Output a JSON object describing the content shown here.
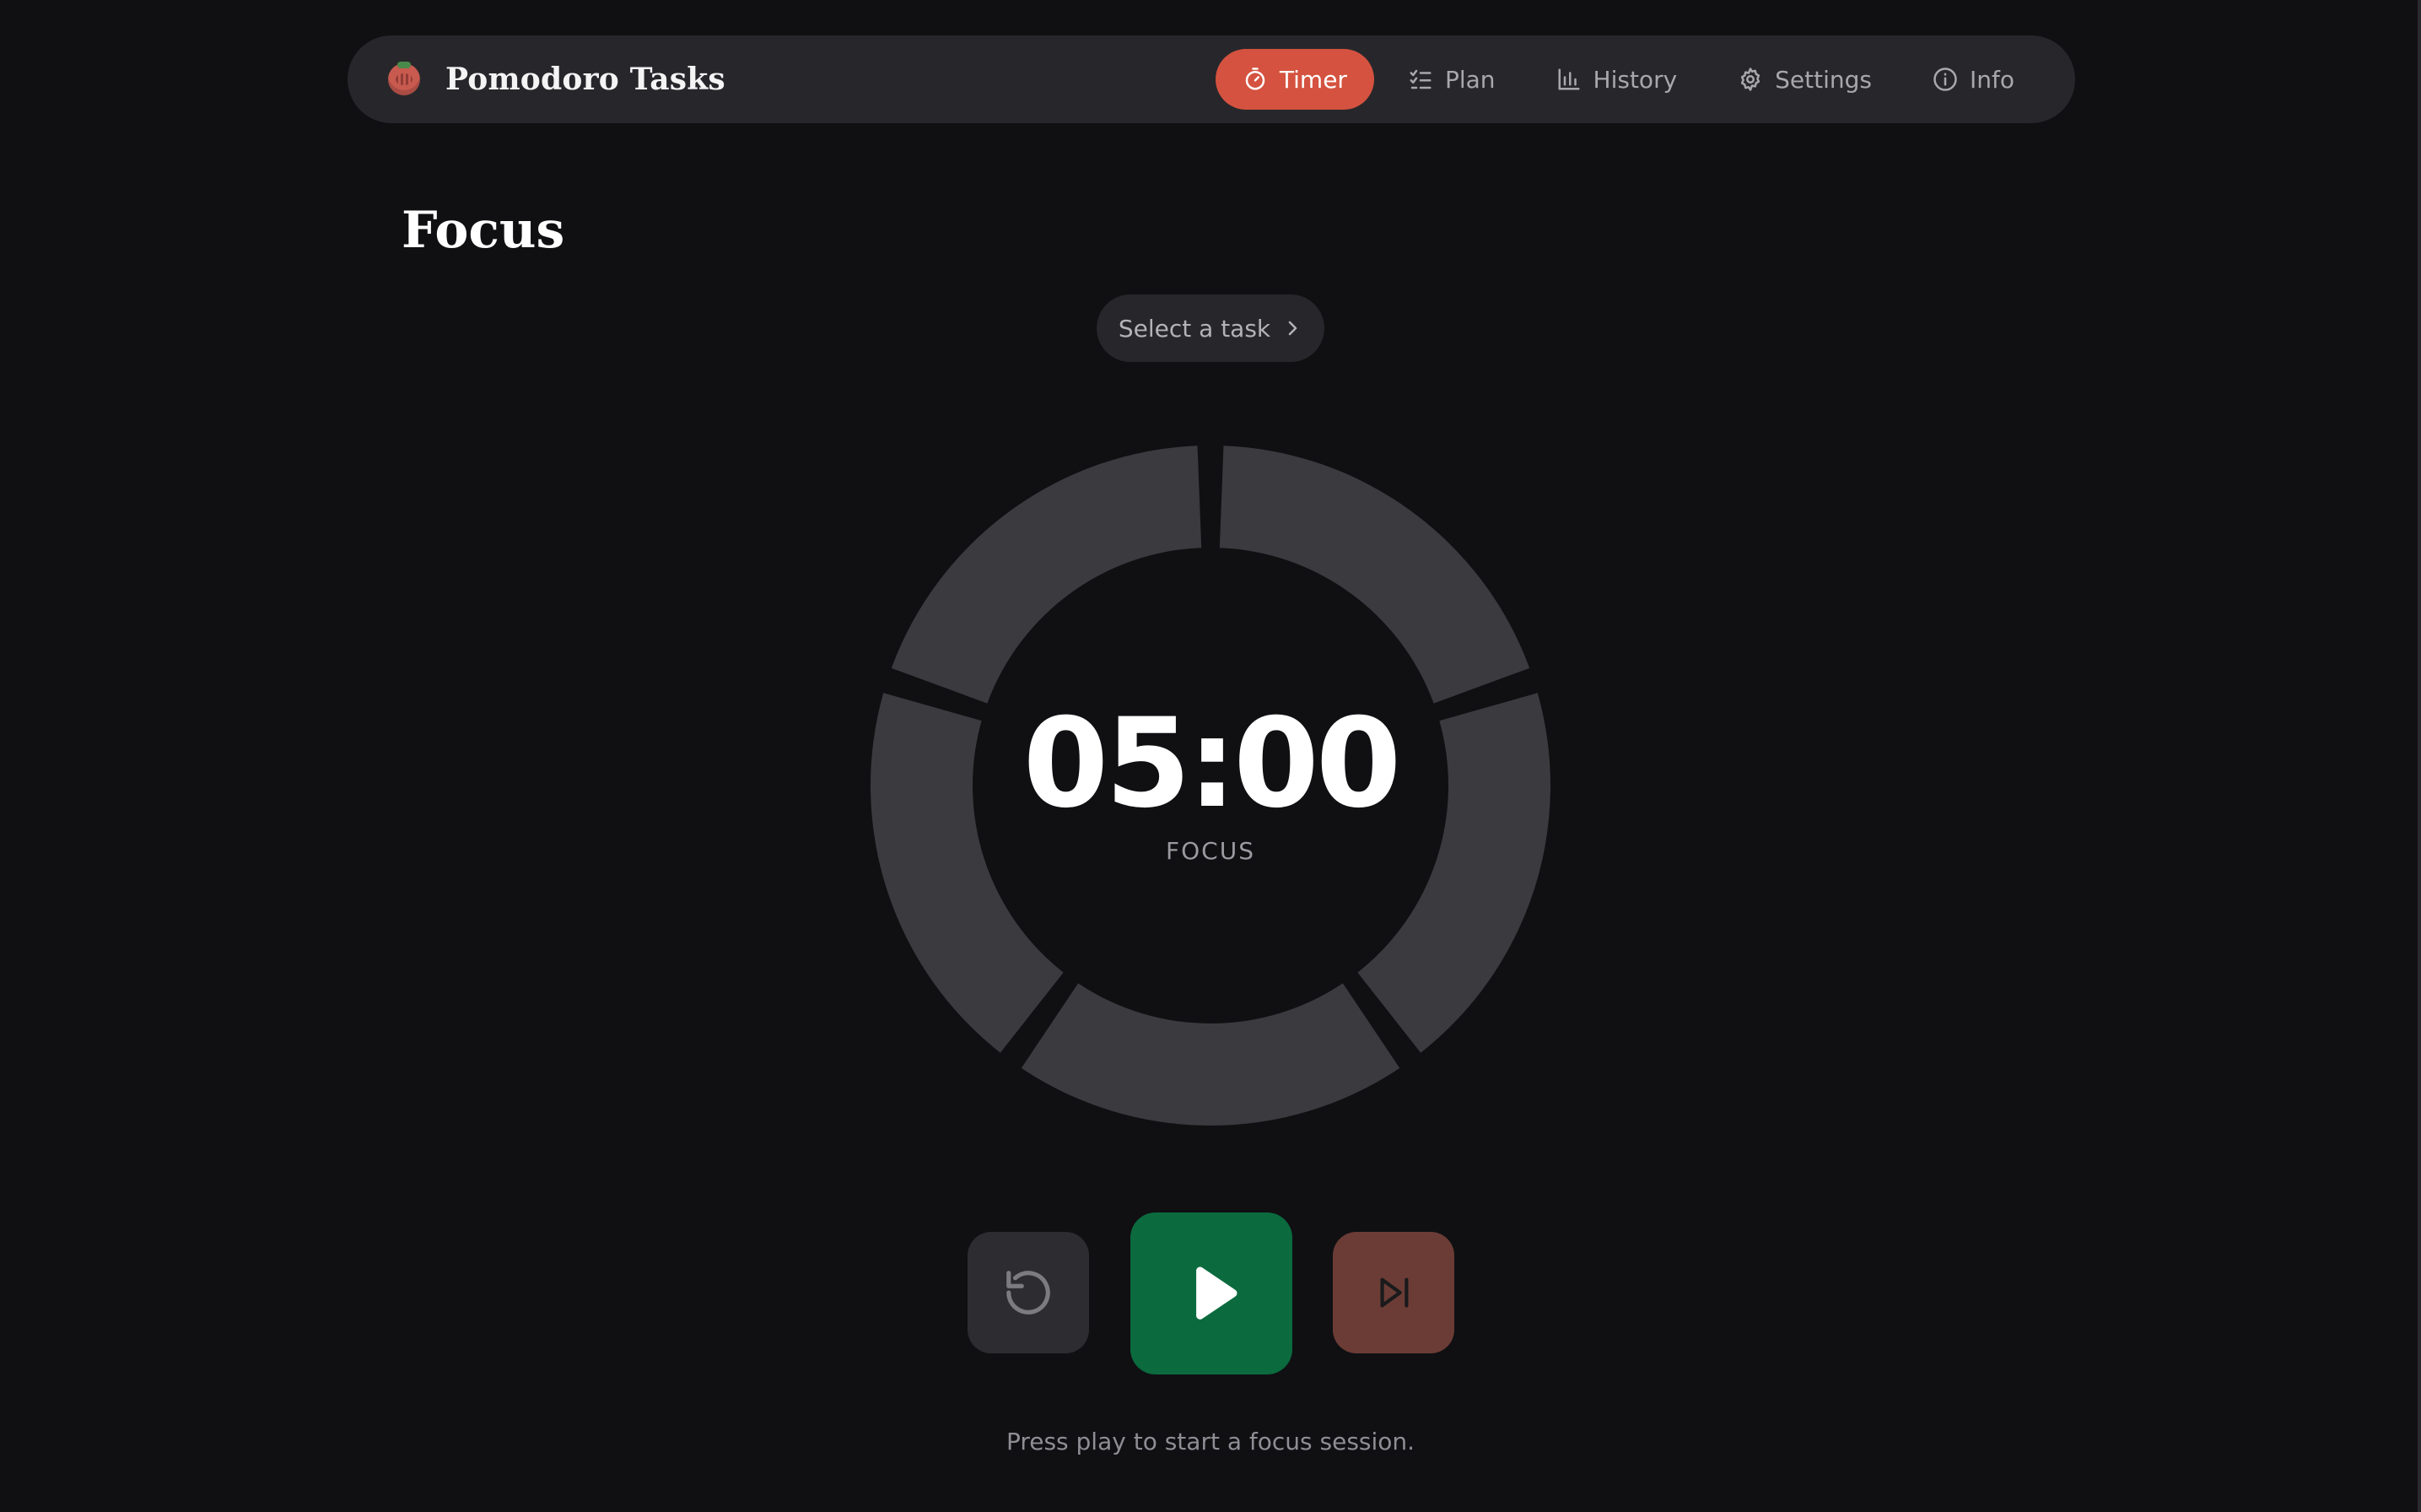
{
  "app": {
    "title": "Pomodoro Tasks",
    "logo_icon": "tomato-icon"
  },
  "nav": {
    "items": [
      {
        "label": "Timer",
        "icon": "stopwatch-icon",
        "active": true
      },
      {
        "label": "Plan",
        "icon": "checklist-icon",
        "active": false
      },
      {
        "label": "History",
        "icon": "bar-chart-icon",
        "active": false
      },
      {
        "label": "Settings",
        "icon": "gear-icon",
        "active": false
      },
      {
        "label": "Info",
        "icon": "info-icon",
        "active": false
      }
    ]
  },
  "page": {
    "title": "Focus"
  },
  "task_select": {
    "label": "Select a task",
    "icon": "chevron-right-icon"
  },
  "timer": {
    "time": "05:00",
    "mode": "FOCUS",
    "segments_total": 5,
    "segments_completed": 0
  },
  "controls": {
    "reset_icon": "rotate-ccw-icon",
    "play_icon": "play-icon",
    "skip_icon": "skip-forward-icon"
  },
  "hint": "Press play to start a focus session.",
  "colors": {
    "background": "#101013",
    "accent": "#d4523f",
    "play": "#0b6b3e",
    "skip": "#6b3c35",
    "segment": "#3b3b3f"
  }
}
